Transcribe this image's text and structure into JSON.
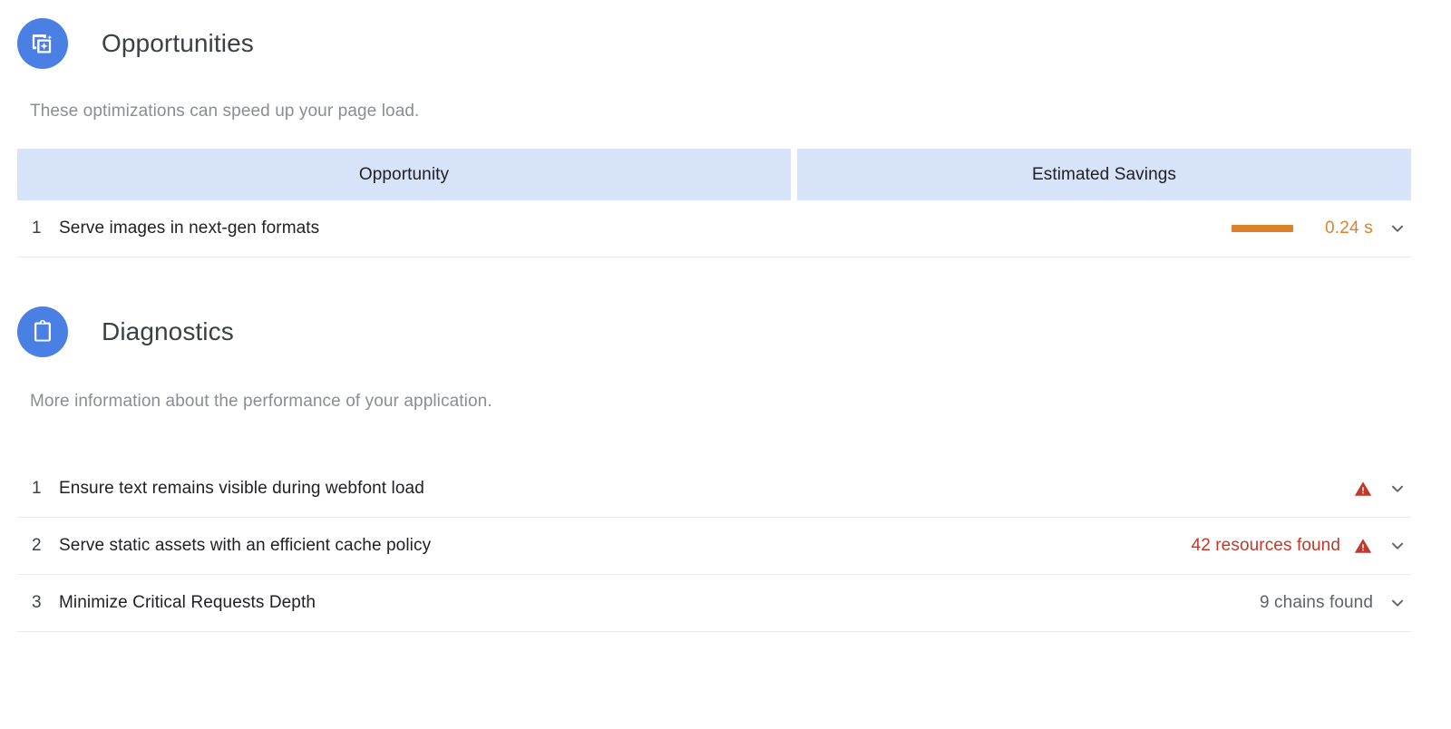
{
  "sections": [
    {
      "id": "opportunities",
      "icon": "image-sparkle-icon",
      "title": "Opportunities",
      "description": "These optimizations can speed up your page load.",
      "table": {
        "headers": [
          "Opportunity",
          "Estimated Savings"
        ],
        "rows": [
          {
            "index": "1",
            "title": "Serve images in next-gen formats",
            "savings_text": "0.24 s",
            "bar_ratio": 0.55,
            "severity": "average",
            "expand_icon": "chevron-down-icon"
          }
        ]
      }
    },
    {
      "id": "diagnostics",
      "icon": "clipboard-icon",
      "title": "Diagnostics",
      "description": "More information about the performance of your application.",
      "table": {
        "headers": [],
        "rows": [
          {
            "index": "1",
            "title": "Ensure text remains visible during webfont load",
            "value_text": "",
            "severity": "error",
            "warn_icon": "warning-triangle-icon",
            "expand_icon": "chevron-down-icon"
          },
          {
            "index": "2",
            "title": "Serve static assets with an efficient cache policy",
            "value_text": "42 resources found",
            "severity": "error",
            "warn_icon": "warning-triangle-icon",
            "expand_icon": "chevron-down-icon"
          },
          {
            "index": "3",
            "title": "Minimize Critical Requests Depth",
            "value_text": "9 chains found",
            "severity": "none",
            "warn_icon": "",
            "expand_icon": "chevron-down-icon"
          }
        ]
      }
    }
  ],
  "colors": {
    "icon_circle_blue": "#4a7fe3",
    "table_header_blue": "#d7e3f9",
    "savings_orange": "#d9822b",
    "error_red": "#c0392b",
    "neutral_gray": "#5f6368",
    "description_gray": "#8a8d91",
    "divider": "#ebebeb"
  }
}
